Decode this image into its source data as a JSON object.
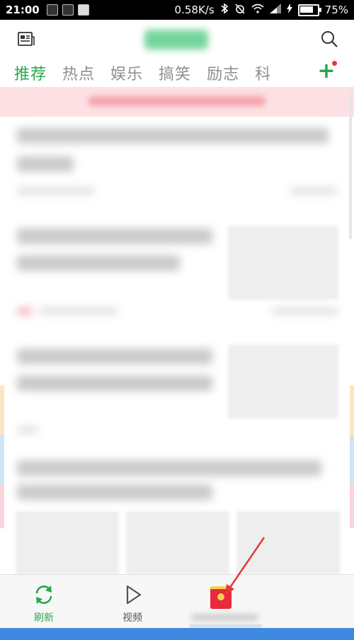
{
  "status_bar": {
    "time": "21:00",
    "net_speed": "0.58K/s",
    "battery": "75%",
    "battery_level": 0.75
  },
  "header": {
    "tabs": [
      "推荐",
      "热点",
      "娱乐",
      "搞笑",
      "励志",
      "科"
    ],
    "active_tab": 0
  },
  "bottom_nav": {
    "refresh_label": "刷新",
    "video_label": "视频"
  },
  "colors": {
    "accent": "#28a84f",
    "banner_bg": "#fde0e3",
    "annotation_arrow": "#e53935",
    "system_bar": "#3f8ae0"
  }
}
